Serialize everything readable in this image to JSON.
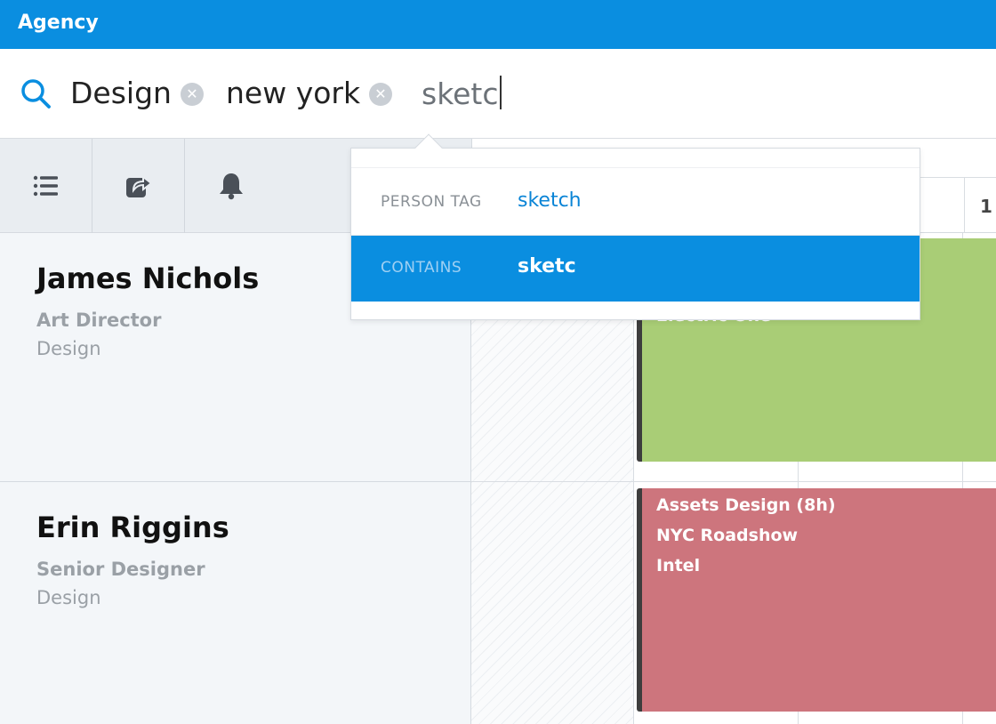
{
  "app": {
    "title": "Agency"
  },
  "search": {
    "tokens": [
      {
        "label": "Design"
      },
      {
        "label": "new york"
      }
    ],
    "typed": "sketc"
  },
  "suggestions": [
    {
      "kind": "PERSON TAG",
      "value": "sketch",
      "selected": false
    },
    {
      "kind": "CONTAINS",
      "value": "sketc",
      "selected": true
    }
  ],
  "calendar": {
    "day_partial": "1"
  },
  "people": [
    {
      "name": "James Nichols",
      "role": "Art Director",
      "department": "Design"
    },
    {
      "name": "Erin Riggins",
      "role": "Senior Designer",
      "department": "Design"
    }
  ],
  "assignments": {
    "james": {
      "line1": "Electric One",
      "color": "#a9cd76"
    },
    "erin": {
      "line1": "Assets Design (8h)",
      "line2": "NYC Roadshow",
      "line3": "Intel",
      "color": "#cd757d"
    }
  },
  "toolbar": {
    "icons": [
      "list-icon",
      "share-icon",
      "bell-icon"
    ]
  },
  "colors": {
    "accent": "#0a8ee0",
    "link": "#0a84d6"
  }
}
